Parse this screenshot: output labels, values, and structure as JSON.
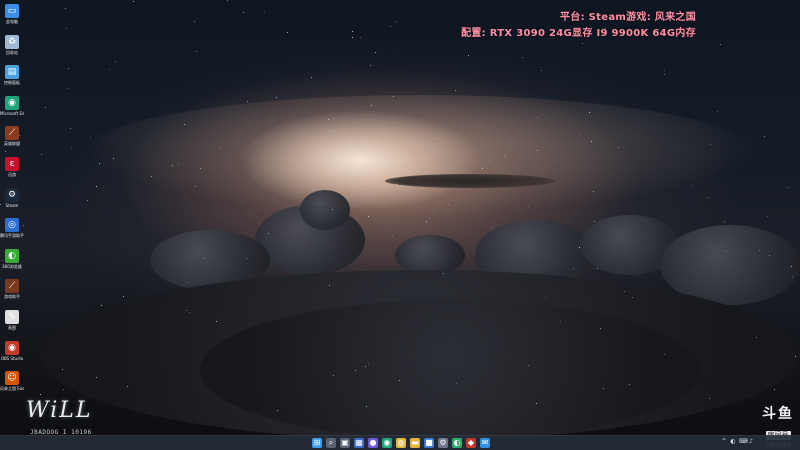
{
  "overlay": {
    "platform": "平台: Steam游戏: 风来之国",
    "config": "配置: RTX 3090 24G显存 I9 9900K 64G内存"
  },
  "watermark": {
    "name": "WiLL",
    "id": "JBADOOG I 10196"
  },
  "douyu": {
    "logo": "斗鱼",
    "room_label": "房间号",
    "room_number": "190946"
  },
  "desktop_icons": [
    {
      "label": "此电脑",
      "icon": "monitor-icon",
      "color": "#3a8ee6"
    },
    {
      "label": "回收站",
      "icon": "recycle-bin-icon",
      "color": "#9fb8d4"
    },
    {
      "label": "控制面板",
      "icon": "control-panel-icon",
      "color": "#4aa3df"
    },
    {
      "label": "Microsoft Edge",
      "icon": "edge-icon",
      "color": "#1fa37a"
    },
    {
      "label": "英雄联盟",
      "icon": "game-sword-icon",
      "color": "#8a3b22"
    },
    {
      "label": "迅游",
      "icon": "xunyou-icon",
      "color": "#c8102e"
    },
    {
      "label": "Steam",
      "icon": "steam-icon",
      "color": "#1b2838"
    },
    {
      "label": "腾讯手游助手",
      "icon": "tencent-helper-icon",
      "color": "#2d6fd6"
    },
    {
      "label": "360浏览器",
      "icon": "browser-360-icon",
      "color": "#3aa935"
    },
    {
      "label": "游戏助手",
      "icon": "game-helper-icon",
      "color": "#7a3a20"
    },
    {
      "label": "画图",
      "icon": "paint-icon",
      "color": "#e0e0e0"
    },
    {
      "label": "OBS Studio",
      "icon": "obs-icon",
      "color": "#c0392b"
    },
    {
      "label": "风来之国 Eastward",
      "icon": "eastward-icon",
      "color": "#d35400"
    }
  ],
  "taskbar": {
    "apps": [
      {
        "name": "start-icon",
        "glyph": "⊞",
        "color": "#3a9cf0"
      },
      {
        "name": "search-icon",
        "glyph": "⌕",
        "color": "#596273"
      },
      {
        "name": "task-view-icon",
        "glyph": "▣",
        "color": "#596273"
      },
      {
        "name": "widgets-icon",
        "glyph": "▦",
        "color": "#3b6ac9"
      },
      {
        "name": "chat-icon",
        "glyph": "●",
        "color": "#6b5bd8"
      },
      {
        "name": "edge-icon",
        "glyph": "◉",
        "color": "#1fa37a"
      },
      {
        "name": "chrome-icon",
        "glyph": "◍",
        "color": "#e2b93b"
      },
      {
        "name": "file-explorer-icon",
        "glyph": "▬",
        "color": "#e6b23a"
      },
      {
        "name": "store-icon",
        "glyph": "■",
        "color": "#3a7bd5"
      },
      {
        "name": "settings-icon",
        "glyph": "⚙",
        "color": "#6c7686"
      },
      {
        "name": "wechat-icon",
        "glyph": "◐",
        "color": "#2aae67"
      },
      {
        "name": "game-icon",
        "glyph": "◆",
        "color": "#c0392b"
      },
      {
        "name": "mail-icon",
        "glyph": "✉",
        "color": "#2f8fe0"
      }
    ],
    "tray": [
      "^",
      "◐",
      "⌨",
      "♪"
    ]
  }
}
